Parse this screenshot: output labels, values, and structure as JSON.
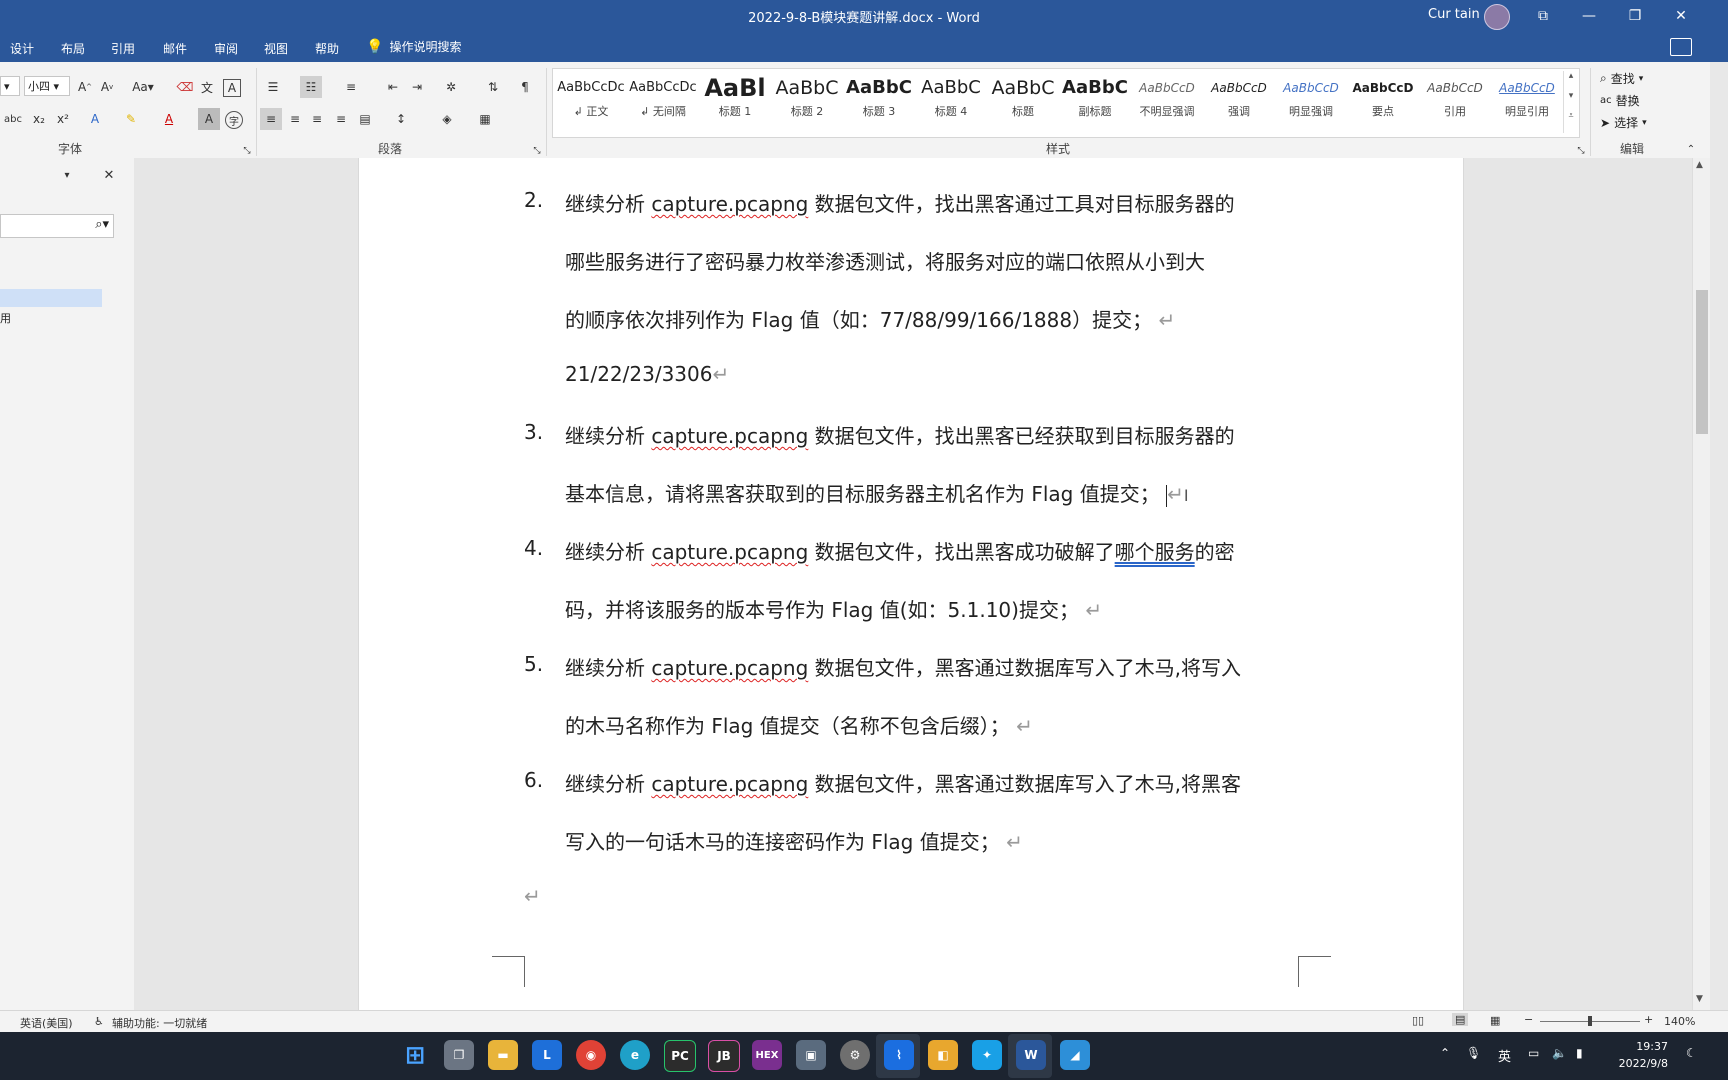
{
  "window": {
    "title": "2022-9-8-B模块赛题讲解.docx  -  Word",
    "user": "Cur tain",
    "controls": {
      "ribbon_display": "⧉",
      "minimize": "—",
      "restore": "❐",
      "close": "✕"
    }
  },
  "menu": {
    "items": [
      "设计",
      "布局",
      "引用",
      "邮件",
      "审阅",
      "视图",
      "帮助"
    ],
    "tell_me": "操作说明搜索"
  },
  "ribbon": {
    "font": {
      "font_size": "小四",
      "label": "字体"
    },
    "paragraph": {
      "label": "段落"
    },
    "styles": {
      "label": "样式",
      "items": [
        {
          "sample": "AaBbCcDc",
          "name": "↲ 正文"
        },
        {
          "sample": "AaBbCcDc",
          "name": "↲ 无间隔"
        },
        {
          "sample": "AaBl",
          "name": "标题 1"
        },
        {
          "sample": "AaBbC",
          "name": "标题 2"
        },
        {
          "sample": "AaBbC",
          "name": "标题 3"
        },
        {
          "sample": "AaBbC",
          "name": "标题 4"
        },
        {
          "sample": "AaBbC",
          "name": "标题"
        },
        {
          "sample": "AaBbC",
          "name": "副标题"
        },
        {
          "sample": "AaBbCcD",
          "name": "不明显强调"
        },
        {
          "sample": "AaBbCcD",
          "name": "强调"
        },
        {
          "sample": "AaBbCcD",
          "name": "明显强调"
        },
        {
          "sample": "AaBbCcD",
          "name": "要点"
        },
        {
          "sample": "AaBbCcD",
          "name": "引用"
        },
        {
          "sample": "AaBbCcD",
          "name": "明显引用"
        }
      ]
    },
    "editing": {
      "label": "编辑",
      "find": "查找",
      "replace": "替换",
      "select": "选择"
    }
  },
  "nav_pane": {
    "partial_item": "用"
  },
  "document": {
    "items": [
      {
        "num": "2.",
        "lines": [
          {
            "pre": "继续分析 ",
            "spell": "capture.pcapng",
            "post": " 数据包文件，找出黑客通过工具对目标服务器的"
          },
          {
            "pre": "哪些服务进行了密码暴力枚举渗透测试，将服务对应的端口依照从小到大"
          },
          {
            "pre": "的顺序依次排列作为 Flag 值（如：77/88/99/166/1888）提交；"
          }
        ]
      },
      {
        "answer": "21/22/23/3306"
      },
      {
        "num": "3.",
        "lines": [
          {
            "pre": "继续分析 ",
            "spell": "capture.pcapng",
            "post": " 数据包文件，找出黑客已经获取到目标服务器的"
          },
          {
            "pre": "基本信息，请将黑客获取到的目标服务器主机名作为 Flag 值提交；"
          }
        ]
      },
      {
        "num": "4.",
        "lines": [
          {
            "pre": "继续分析 ",
            "spell": "capture.pcapng",
            "post": " 数据包文件，找出黑客成功破解了",
            "gram": "哪个服务",
            "post2": "的密"
          },
          {
            "pre": "码，并将该服务的版本号作为 Flag 值(如：5.1.10)提交；"
          }
        ]
      },
      {
        "num": "5.",
        "lines": [
          {
            "pre": "继续分析 ",
            "spell": "capture.pcapng",
            "post": " 数据包文件，黑客通过数据库写入了木马,将写入"
          },
          {
            "pre": "的木马名称作为 Flag 值提交（名称不包含后缀）；"
          }
        ]
      },
      {
        "num": "6.",
        "lines": [
          {
            "pre": "继续分析 ",
            "spell": "capture.pcapng",
            "post": " 数据包文件，黑客通过数据库写入了木马,将黑客"
          },
          {
            "pre": "写入的一句话木马的连接密码作为 Flag 值提交；"
          }
        ]
      }
    ],
    "paragraph_mark": "↵"
  },
  "status_bar": {
    "language": "英语(美国)",
    "accessibility": "辅助功能: 一切就绪",
    "zoom": "140%"
  },
  "taskbar": {
    "ime": "英",
    "time": "19:37",
    "date": "2022/9/8"
  }
}
